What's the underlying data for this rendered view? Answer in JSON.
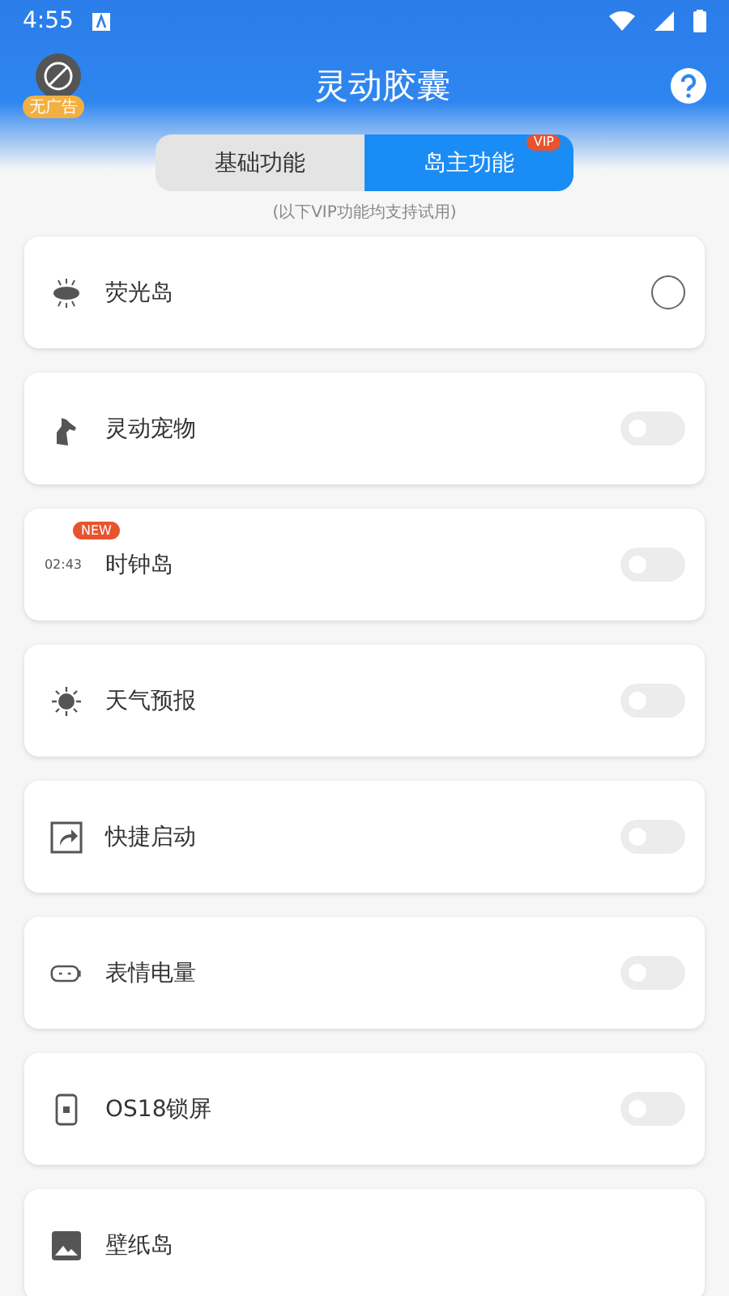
{
  "status_bar": {
    "time": "4:55"
  },
  "header": {
    "title": "灵动胶囊",
    "ad_badge": "无广告"
  },
  "tabs": [
    {
      "label": "基础功能",
      "selected": false
    },
    {
      "label": "岛主功能",
      "selected": true,
      "badge": "VIP"
    }
  ],
  "caption": "(以下VIP功能均支持试用)",
  "features": [
    {
      "label": "荧光岛",
      "kind": "radio",
      "checked": false
    },
    {
      "label": "灵动宠物",
      "kind": "toggle",
      "on": false
    },
    {
      "label": "时钟岛",
      "kind": "toggle",
      "on": false,
      "badge": "NEW",
      "icon_text": "02:43"
    },
    {
      "label": "天气预报",
      "kind": "toggle",
      "on": false
    },
    {
      "label": "快捷启动",
      "kind": "toggle",
      "on": false
    },
    {
      "label": "表情电量",
      "kind": "toggle",
      "on": false
    },
    {
      "label": "OS18锁屏",
      "kind": "toggle",
      "on": false
    },
    {
      "label": "壁纸岛",
      "kind": "plain"
    }
  ]
}
